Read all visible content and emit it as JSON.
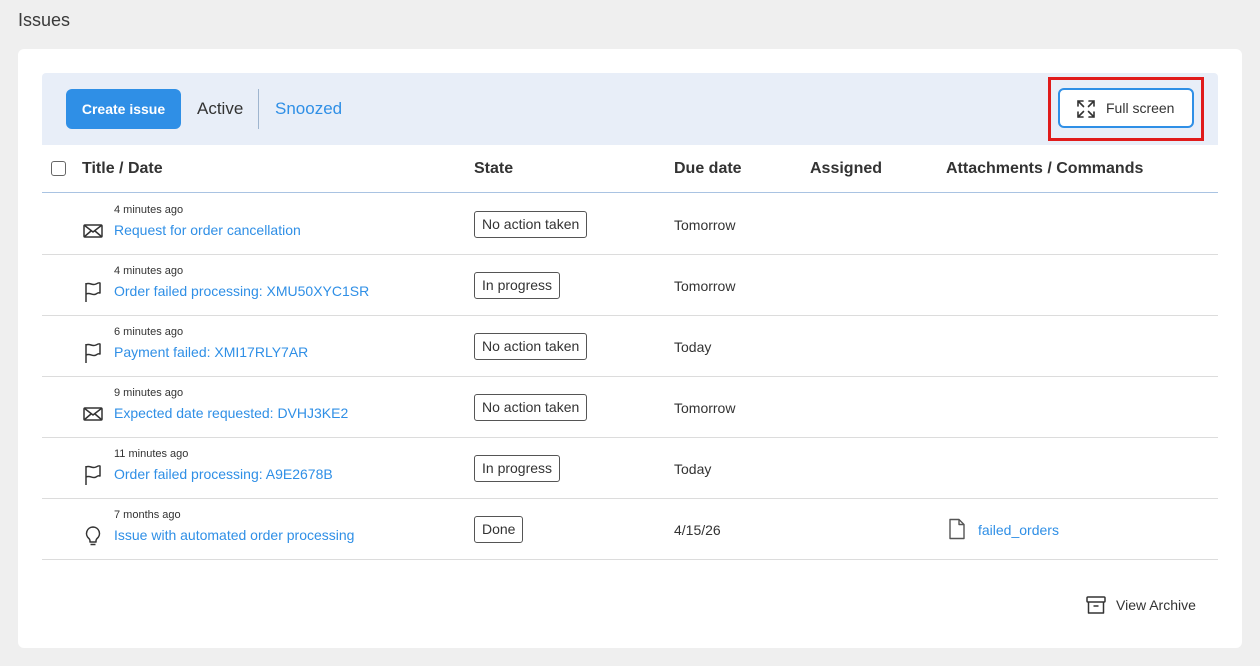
{
  "page": {
    "title": "Issues"
  },
  "toolbar": {
    "create_label": "Create issue",
    "tabs": [
      {
        "label": "Active",
        "selected": true
      },
      {
        "label": "Snoozed",
        "selected": false
      }
    ],
    "fullscreen_label": "Full screen"
  },
  "table": {
    "columns": [
      "Title / Date",
      "State",
      "Due date",
      "Assigned",
      "Attachments / Commands"
    ],
    "rows": [
      {
        "icon": "envelope-icon",
        "time": "4 minutes ago",
        "title": "Request for order cancellation",
        "state": "No action taken",
        "due": "Tomorrow",
        "assigned": "",
        "attachment": ""
      },
      {
        "icon": "flag-icon",
        "time": "4 minutes ago",
        "title": "Order failed processing: XMU50XYC1SR",
        "state": "In progress",
        "due": "Tomorrow",
        "assigned": "",
        "attachment": ""
      },
      {
        "icon": "flag-icon",
        "time": "6 minutes ago",
        "title": "Payment failed: XMI17RLY7AR",
        "state": "No action taken",
        "due": "Today",
        "assigned": "",
        "attachment": ""
      },
      {
        "icon": "envelope-icon",
        "time": "9 minutes ago",
        "title": "Expected date requested: DVHJ3KE2",
        "state": "No action taken",
        "due": "Tomorrow",
        "assigned": "",
        "attachment": ""
      },
      {
        "icon": "flag-icon",
        "time": "11 minutes ago",
        "title": "Order failed processing: A9E2678B",
        "state": "In progress",
        "due": "Today",
        "assigned": "",
        "attachment": ""
      },
      {
        "icon": "lightbulb-icon",
        "time": "7 months ago",
        "title": "Issue with automated order processing",
        "state": "Done",
        "due": "4/15/26",
        "assigned": "",
        "attachment": "failed_orders"
      }
    ]
  },
  "footer": {
    "archive_label": "View Archive"
  },
  "colors": {
    "accent": "#2f8fe6",
    "toolbar_bg": "#e8eef8",
    "highlight": "#e01b1b"
  }
}
